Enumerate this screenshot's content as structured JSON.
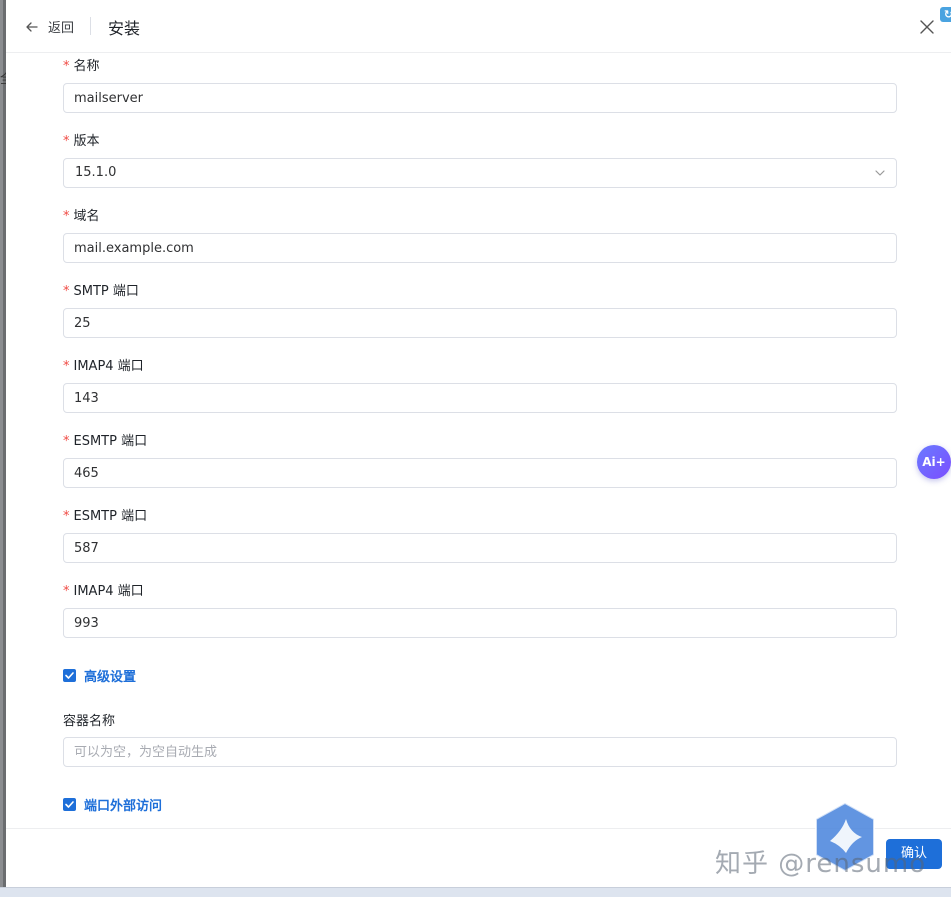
{
  "header": {
    "back_label": "返回",
    "title": "安装",
    "corner_badge": "↻"
  },
  "form": {
    "name": {
      "label": "名称",
      "value": "mailserver"
    },
    "version": {
      "label": "版本",
      "value": "15.1.0"
    },
    "domain": {
      "label": "域名",
      "value": "mail.example.com"
    },
    "smtp_port": {
      "label": "SMTP 端口",
      "value": "25"
    },
    "imap4_port": {
      "label": "IMAP4 端口",
      "value": "143"
    },
    "esmtp_port_1": {
      "label": "ESMTP 端口",
      "value": "465"
    },
    "esmtp_port_2": {
      "label": "ESMTP 端口",
      "value": "587"
    },
    "imap4_port_2": {
      "label": "IMAP4 端口",
      "value": "993"
    },
    "required_mark": "*",
    "advanced": {
      "label": "高级设置",
      "checked": true
    },
    "container_name": {
      "label": "容器名称",
      "placeholder": "可以为空，为空自动生成",
      "value": ""
    },
    "external_access": {
      "label": "端口外部访问",
      "checked": true
    }
  },
  "footer": {
    "confirm_label": "确认"
  },
  "floating": {
    "ai_label": "Ai+"
  },
  "watermark": {
    "text": "知乎 @rensumo"
  },
  "left_bleed_text": "全",
  "colors": {
    "primary": "#1e6fd9",
    "required": "#f04a44",
    "border": "#dcdfe6"
  }
}
